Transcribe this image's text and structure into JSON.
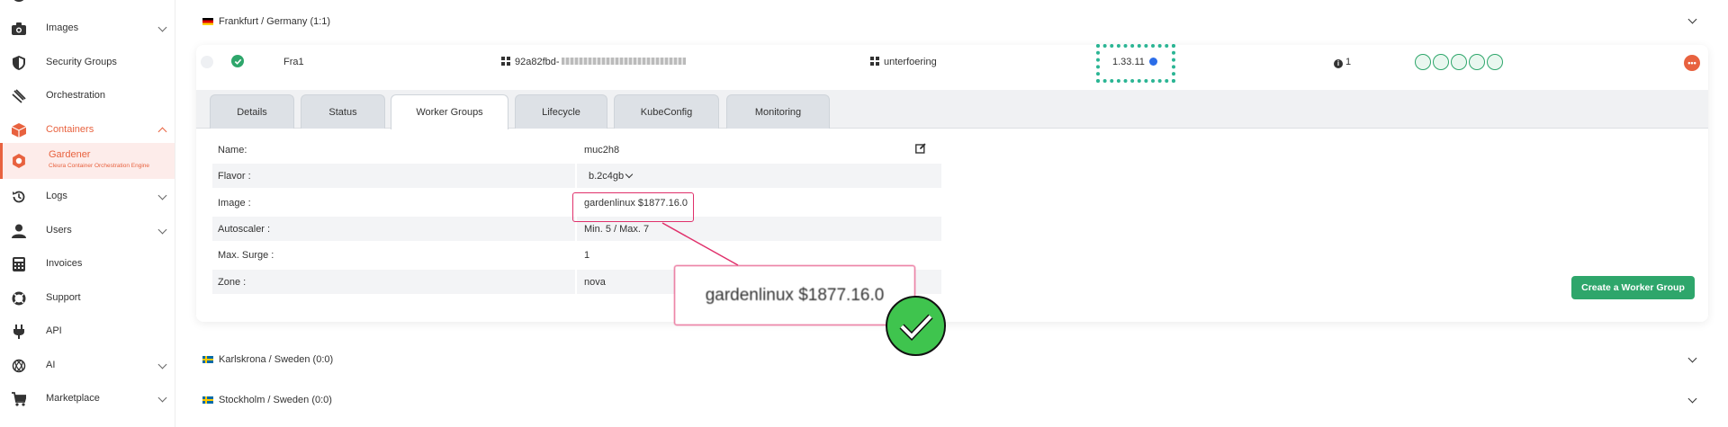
{
  "sidebar": {
    "items": [
      {
        "label": "Images",
        "icon": "camera-icon"
      },
      {
        "label": "Security Groups",
        "icon": "shield-icon"
      },
      {
        "label": "Orchestration",
        "icon": "orchestration-icon"
      },
      {
        "label": "Containers",
        "icon": "container-icon"
      },
      {
        "label": "Gardener",
        "sub": "Cleura Container Orchestration Engine",
        "icon": "gardener-icon"
      },
      {
        "label": "Logs",
        "icon": "history-icon"
      },
      {
        "label": "Users",
        "icon": "user-icon"
      },
      {
        "label": "Invoices",
        "icon": "calculator-icon"
      },
      {
        "label": "Support",
        "icon": "lifebuoy-icon"
      },
      {
        "label": "API",
        "icon": "plug-icon"
      },
      {
        "label": "AI",
        "icon": "ai-icon"
      },
      {
        "label": "Marketplace",
        "icon": "cart-icon"
      }
    ]
  },
  "regions": {
    "frankfurt": "Frankfurt / Germany (1:1)",
    "karlskrona": "Karlskrona / Sweden (0:0)",
    "stockholm": "Stockholm / Sweden (0:0)"
  },
  "cluster": {
    "name": "Fra1",
    "id": "92a82fbd-",
    "project": "unterfoering",
    "version": "1.33.11",
    "workers": "1"
  },
  "tabs": [
    "Details",
    "Status",
    "Worker Groups",
    "Lifecycle",
    "KubeConfig",
    "Monitoring"
  ],
  "worker_group": {
    "rows": [
      {
        "key": "Name:",
        "value": "muc2h8"
      },
      {
        "key": "Flavor :",
        "value": "b.2c4gb"
      },
      {
        "key": "Image :",
        "value": "gardenlinux $1877.16.0"
      },
      {
        "key": "Autoscaler :",
        "value": "Min. 5 / Max. 7"
      },
      {
        "key": "Max. Surge :",
        "value": "1"
      },
      {
        "key": "Zone :",
        "value": "nova"
      }
    ]
  },
  "create_button": "Create a Worker Group",
  "zoom_text": "gardenlinux $1877.16.0",
  "colors": {
    "accent": "#e8623f",
    "green": "#2ea66b",
    "highlight": "#e0306b",
    "dotted": "#2bb594"
  }
}
